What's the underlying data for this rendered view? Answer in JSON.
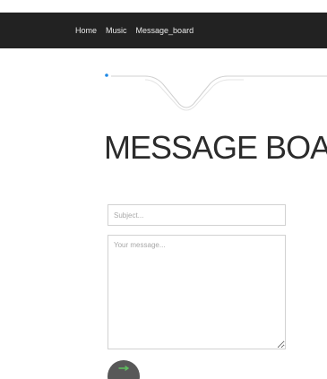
{
  "nav": {
    "items": [
      {
        "label": "Home"
      },
      {
        "label": "Music"
      },
      {
        "label": "Message_board"
      }
    ]
  },
  "page": {
    "title": "MESSAGE BOARD"
  },
  "form": {
    "subject_placeholder": "Subject...",
    "message_placeholder": "Your message..."
  },
  "icons": {
    "divider": "decorative-wave-divider-icon",
    "submit": "arrow-icon"
  },
  "colors": {
    "navbar": "#222222",
    "divider_dot": "#1e88e5",
    "button": "#585858",
    "button_icon": "#5fbf5f"
  }
}
